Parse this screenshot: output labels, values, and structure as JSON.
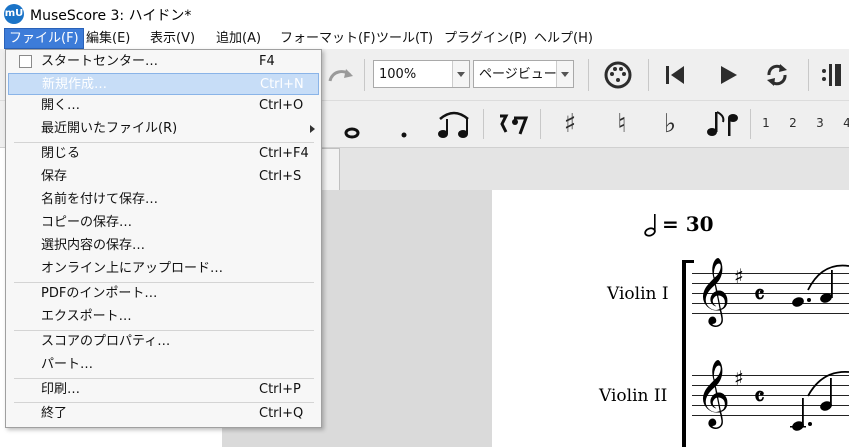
{
  "window": {
    "title": "MuseScore 3: ハイドン*",
    "logo_text": "mU"
  },
  "menubar": {
    "items": [
      {
        "label": "ファイル(F)"
      },
      {
        "label": "編集(E)"
      },
      {
        "label": "表示(V)"
      },
      {
        "label": "追加(A)"
      },
      {
        "label": "フォーマット(F)"
      },
      {
        "label": "ツール(T)"
      },
      {
        "label": "プラグイン(P)"
      },
      {
        "label": "ヘルプ(H)"
      }
    ]
  },
  "toolbar": {
    "zoom_value": "100%",
    "view_mode": "ページビュー",
    "voice_numbers": [
      "1",
      "2",
      "3",
      "4"
    ]
  },
  "file_menu": {
    "items": [
      {
        "label": "スタートセンター…",
        "shortcut": "F4"
      },
      {
        "label": "新規作成…",
        "shortcut": "Ctrl+N"
      },
      {
        "label": "開く…",
        "shortcut": "Ctrl+O"
      },
      {
        "label": "最近開いたファイル(R)",
        "shortcut": ""
      },
      {
        "label": "閉じる",
        "shortcut": "Ctrl+F4"
      },
      {
        "label": "保存",
        "shortcut": "Ctrl+S"
      },
      {
        "label": "名前を付けて保存…",
        "shortcut": ""
      },
      {
        "label": "コピーの保存…",
        "shortcut": ""
      },
      {
        "label": "選択内容の保存…",
        "shortcut": ""
      },
      {
        "label": "オンライン上にアップロード…",
        "shortcut": ""
      },
      {
        "label": "PDFのインポート…",
        "shortcut": ""
      },
      {
        "label": "エクスポート…",
        "shortcut": ""
      },
      {
        "label": "スコアのプロパティ…",
        "shortcut": ""
      },
      {
        "label": "パート…",
        "shortcut": ""
      },
      {
        "label": "印刷…",
        "shortcut": "Ctrl+P"
      },
      {
        "label": "終了",
        "shortcut": "Ctrl+Q"
      }
    ]
  },
  "score": {
    "tempo_value": "= 30",
    "instruments": [
      "Violin I",
      "Violin II"
    ],
    "time_signature": "𝄴"
  },
  "colors": {
    "menu_highlight": "#3d7cd9",
    "item_highlight": "#c7ddf7"
  }
}
